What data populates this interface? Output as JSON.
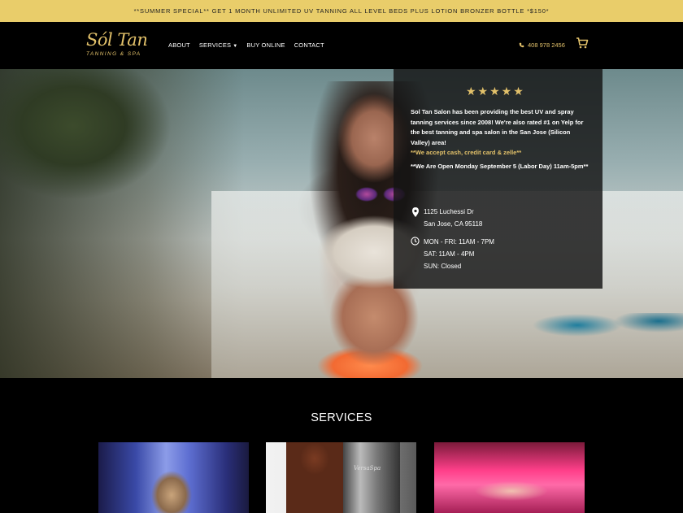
{
  "promo_bar": {
    "text": "**SUMMER SPECIAL** GET 1 MONTH UNLIMITED UV TANNING ALL LEVEL BEDS PLUS LOTION BRONZER BOTTLE *$150*"
  },
  "header": {
    "logo": {
      "script": "Sól Tan",
      "sub": "TANNING & SPA"
    },
    "nav": [
      {
        "label": "ABOUT"
      },
      {
        "label": "SERVICES",
        "has_dropdown": true
      },
      {
        "label": "BUY ONLINE"
      },
      {
        "label": "CONTACT"
      }
    ],
    "phone": "408 978 2456",
    "icons": {
      "phone": "phone-icon",
      "cart": "cart-icon",
      "dropdown": "chevron-down-icon"
    }
  },
  "info_panel": {
    "stars": "★★★★★",
    "rating": 5,
    "intro": "Sol Tan Salon has been providing the best UV and spray tanning services since 2008! We're also rated #1 on Yelp for the best tanning and spa salon in the San Jose (Silicon Valley) area!",
    "payment_note": "**We accept cash, credit card & zelle**",
    "holiday_note": "**We Are Open Monday September 5 (Labor Day)  11am-5pm**",
    "address_line1": "1125 Luchessi Dr",
    "address_line2": "San Jose, CA 95118",
    "hours": [
      "MON - FRI: 11AM - 7PM",
      "SAT: 11AM - 4PM",
      "SUN: Closed"
    ]
  },
  "services": {
    "title": "SERVICES",
    "cards": [
      {
        "name": "uv-tanning"
      },
      {
        "name": "spray-tanning",
        "booth_label": "VersaSpa"
      },
      {
        "name": "tanning-bed"
      }
    ]
  },
  "colors": {
    "gold": "#e2c16a",
    "promo_bg": "#e9cd6a",
    "background": "#000000"
  }
}
